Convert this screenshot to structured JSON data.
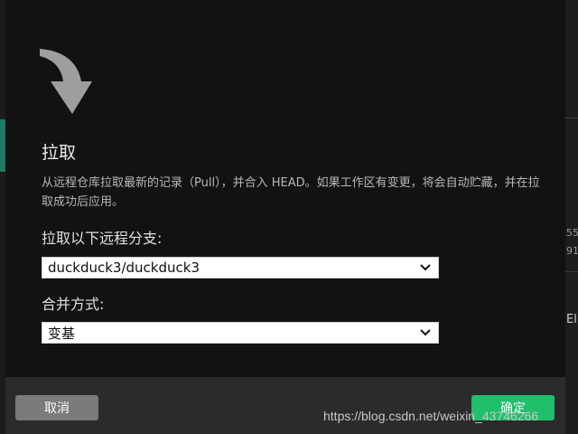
{
  "dialog": {
    "title": "拉取",
    "description": "从远程仓库拉取最新的记录（Pull），并合入 HEAD。如果工作区有变更，将会自动贮藏，并在拉取成功后应用。",
    "branch_label": "拉取以下远程分支:",
    "branch_value": "duckduck3/duckduck3",
    "merge_label": "合并方式:",
    "merge_value": "变基",
    "cancel_label": "取消",
    "ok_label": "确定",
    "icon": "pull-arrow-icon"
  },
  "background": {
    "right_fragments": [
      "55",
      "91",
      "El"
    ]
  },
  "watermark": "https://blog.csdn.net/weixin_43746266",
  "colors": {
    "dialog_bg": "#121212",
    "footer_bg": "#2b2b2b",
    "ok_button": "#1fbf6b",
    "cancel_button": "#7a7a7a",
    "accent_teal": "#1f7a66"
  }
}
